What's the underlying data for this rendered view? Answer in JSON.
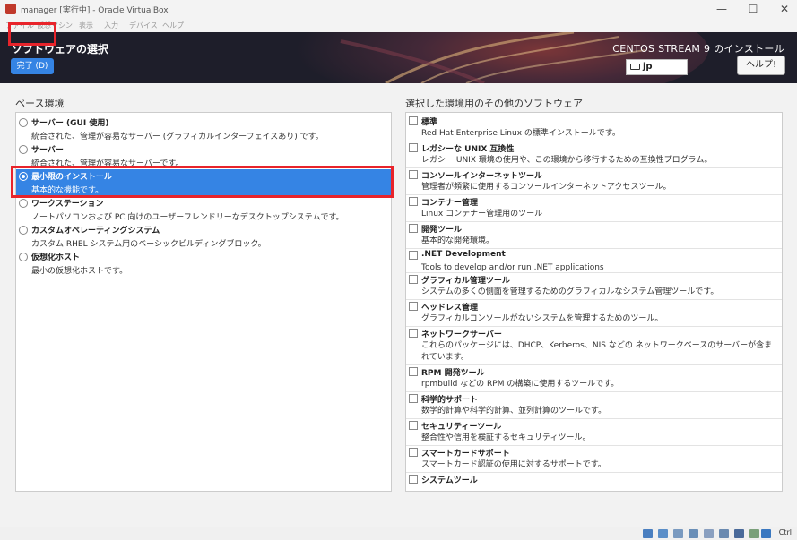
{
  "window": {
    "title": "manager [実行中] - Oracle VirtualBox"
  },
  "menubar": {
    "items": [
      "ファイル",
      "仮想マシン",
      "表示",
      "入力",
      "デバイス",
      "ヘルプ"
    ]
  },
  "header": {
    "spoke_title": "ソフトウェアの選択",
    "done_label": "完了 (D)",
    "product_title": "CENTOS STREAM 9 のインストール",
    "keyboard_layout": "jp",
    "help_label": "ヘルプ!"
  },
  "base_env": {
    "title": "ベース環境",
    "items": [
      {
        "name": "サーバー (GUI 使用)",
        "desc": "統合された、管理が容易なサーバー (グラフィカルインターフェイスあり) です。",
        "selected": false
      },
      {
        "name": "サーバー",
        "desc": "統合された、管理が容易なサーバーです。",
        "selected": false
      },
      {
        "name": "最小限のインストール",
        "desc": "基本的な機能です。",
        "selected": true
      },
      {
        "name": "ワークステーション",
        "desc": "ノートパソコンおよび PC 向けのユーザーフレンドリーなデスクトップシステムです。",
        "selected": false
      },
      {
        "name": "カスタムオペレーティングシステム",
        "desc": "カスタム RHEL システム用のベーシックビルディングブロック。",
        "selected": false
      },
      {
        "name": "仮想化ホスト",
        "desc": "最小の仮想化ホストです。",
        "selected": false
      }
    ]
  },
  "addons": {
    "title": "選択した環境用のその他のソフトウェア",
    "items": [
      {
        "name": "標準",
        "desc": "Red Hat Enterprise Linux の標準インストールです。",
        "checked": false
      },
      {
        "name": "レガシーな UNIX 互換性",
        "desc": "レガシー UNIX 環境の使用や、この環境から移行するための互換性プログラム。",
        "checked": false
      },
      {
        "name": "コンソールインターネットツール",
        "desc": "管理者が頻繁に使用するコンソールインターネットアクセスツール。",
        "checked": false
      },
      {
        "name": "コンテナー管理",
        "desc": "Linux コンテナー管理用のツール",
        "checked": false
      },
      {
        "name": "開発ツール",
        "desc": "基本的な開発環境。",
        "checked": false
      },
      {
        "name": ".NET Development",
        "desc": "Tools to develop and/or run .NET applications",
        "checked": false
      },
      {
        "name": "グラフィカル管理ツール",
        "desc": "システムの多くの側面を管理するためのグラフィカルなシステム管理ツールです。",
        "checked": false
      },
      {
        "name": "ヘッドレス管理",
        "desc": "グラフィカルコンソールがないシステムを管理するためのツール。",
        "checked": false
      },
      {
        "name": "ネットワークサーバー",
        "desc": "これらのパッケージには、DHCP、Kerberos、NIS などの ネットワークベースのサーバーが含まれています。",
        "checked": false
      },
      {
        "name": "RPM 開発ツール",
        "desc": "rpmbuild などの RPM の構築に使用するツールです。",
        "checked": false
      },
      {
        "name": "科学的サポート",
        "desc": "数学的計算や科学的計算、並列計算のツールです。",
        "checked": false
      },
      {
        "name": "セキュリティーツール",
        "desc": "整合性や信用を検証するセキュリティツール。",
        "checked": false
      },
      {
        "name": "スマートカードサポート",
        "desc": "スマートカード認証の使用に対するサポートです。",
        "checked": false
      },
      {
        "name": "システムツール",
        "desc": "",
        "checked": false
      }
    ]
  },
  "statusbar": {
    "host_key": "Ctrl"
  },
  "colors": {
    "accent": "#3584e4",
    "highlight": "#e8242b",
    "header_bg": "#1e1e2a"
  }
}
